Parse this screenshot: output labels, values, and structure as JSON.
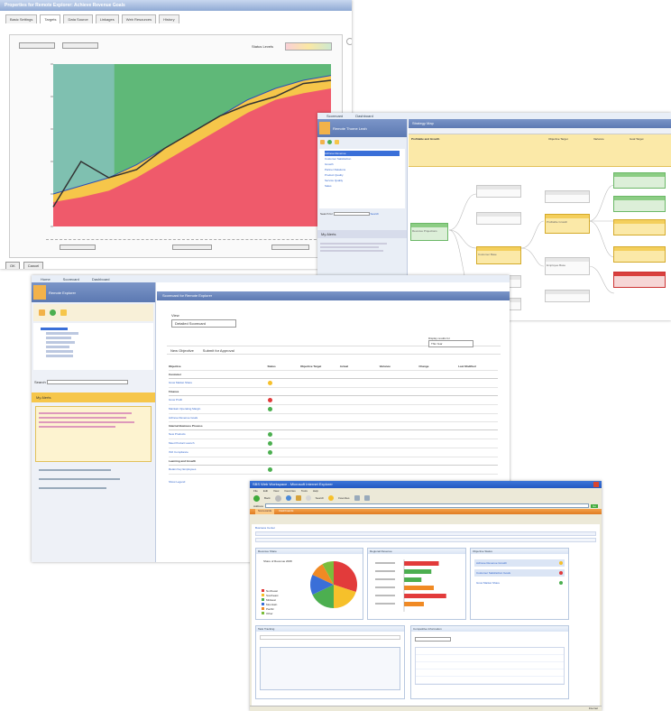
{
  "back_window": {
    "title": "Properties for Remote Explorer: Achieve Revenue Goals",
    "tabs": [
      "Basic Settings",
      "Targets",
      "Data Source",
      "Linkages",
      "Web Resources",
      "History"
    ],
    "active_tab": "Targets",
    "status_labels": "Status Levels",
    "chart_data": {
      "type": "area",
      "series": [
        {
          "values": [
            15,
            18,
            22,
            30,
            40,
            50,
            60,
            70,
            78,
            82,
            85
          ]
        },
        {
          "values": [
            20,
            25,
            30,
            38,
            48,
            58,
            68,
            78,
            85,
            90,
            93
          ]
        },
        {
          "values": [
            12,
            40,
            30,
            35,
            48,
            58,
            68,
            75,
            80,
            88,
            90
          ]
        }
      ],
      "ylim": [
        0,
        100
      ],
      "colors": [
        "#ef5a6b",
        "#f6c64a",
        "#5fb878",
        "#333333"
      ]
    },
    "footer_buttons": [
      "OK",
      "Cancel"
    ]
  },
  "right_window": {
    "tabs": [
      "Scorecard",
      "Dashboard"
    ],
    "user_title": "Remote Thorne Leah",
    "header": "Strategy Map",
    "nav_items": [
      "Achieve Revenue",
      "Customer Satisfaction",
      "Growth",
      "Partner Relations",
      "Product Quality",
      "Service Quality",
      "Sales",
      "Marketing",
      "Innovation"
    ],
    "search_label": "Search for",
    "search_button": "Search",
    "alerts_title": "My Alerts",
    "top_box": {
      "title": "Profitable and Growth",
      "col1": "Objective Target",
      "col2": "Variance",
      "col3": "Goal Target"
    },
    "nodes": [
      "Revenue Projections",
      "Customer Base",
      "Profitable Growth",
      "Employee Base"
    ]
  },
  "middle_window": {
    "tabs": [
      "Home",
      "Scorecard",
      "Dashboard"
    ],
    "user_title": "Remote Explorer",
    "main_title": "Scorecard for Remote Explorer",
    "view_label": "View",
    "view_value": "Detailed Scorecard",
    "buttons": [
      "New Objective",
      "Submit for Approval"
    ],
    "display_label": "Display results for",
    "display_value": "This Year",
    "columns": [
      "Objective",
      "Status",
      "Objective Target",
      "Actual",
      "Variance",
      "Change",
      "Last Modified"
    ],
    "sections": [
      {
        "name": "Customer",
        "rows": [
          "Grow Market Share"
        ]
      },
      {
        "name": "Finance",
        "rows": [
          "Grow Profit",
          "Maintain Operating Margin",
          "Achieve Revenue Goals"
        ]
      },
      {
        "name": "Internal Business Process",
        "rows": [
          "New Products",
          "Meet Product Launch",
          "ISO Compliance"
        ]
      },
      {
        "name": "Learning and Growth",
        "rows": [
          "Retain Key Employees"
        ]
      }
    ],
    "alerts_title": "My Alerts",
    "search_label": "Search",
    "footer_link": "Show Legend"
  },
  "front_window": {
    "title": "SBS Web Workspace - Microsoft Internet Explorer",
    "menu": [
      "File",
      "Edit",
      "View",
      "Favorites",
      "Tools",
      "Help"
    ],
    "toolbar": [
      "Back",
      "Search",
      "Favorites"
    ],
    "address_label": "Address",
    "go_label": "Go",
    "tabs": [
      "Scorecards",
      "Dashboards"
    ],
    "breadcrumb": "Business Center",
    "panels": {
      "pie": {
        "title": "Revenue Share",
        "caption": "Share of Revenue 2008"
      },
      "bars": {
        "title": "Regional Revenue"
      },
      "kpi": {
        "title": "Objective Status",
        "items": [
          "Achieve Revenue Growth",
          "Customer Satisfaction Goals",
          "Grow Market Share"
        ]
      },
      "tasks": {
        "title": "Task Tracking"
      },
      "goals": {
        "title": "Competitive Information"
      }
    },
    "pie_values": [
      30,
      20,
      18,
      14,
      10,
      8
    ],
    "pie_colors": [
      "#e23b3b",
      "#f6c02b",
      "#4caf50",
      "#3a6fd8",
      "#f08a24",
      "#7bbd3b"
    ],
    "legend": [
      "Northeast",
      "Southeast",
      "Midwest",
      "Mountain",
      "Pacific",
      "Other"
    ],
    "bar_values": [
      0.7,
      0.55,
      0.35,
      0.6,
      0.85,
      0.4
    ],
    "bar_colors": [
      "#e23b3b",
      "#4caf50",
      "#4caf50",
      "#f08a24",
      "#e23b3b",
      "#f08a24"
    ],
    "status": "Internet"
  },
  "colors": {
    "accent": "#8fa9d4",
    "yellow": "#f6c64a",
    "red": "#e23b3b",
    "green": "#4caf50"
  }
}
